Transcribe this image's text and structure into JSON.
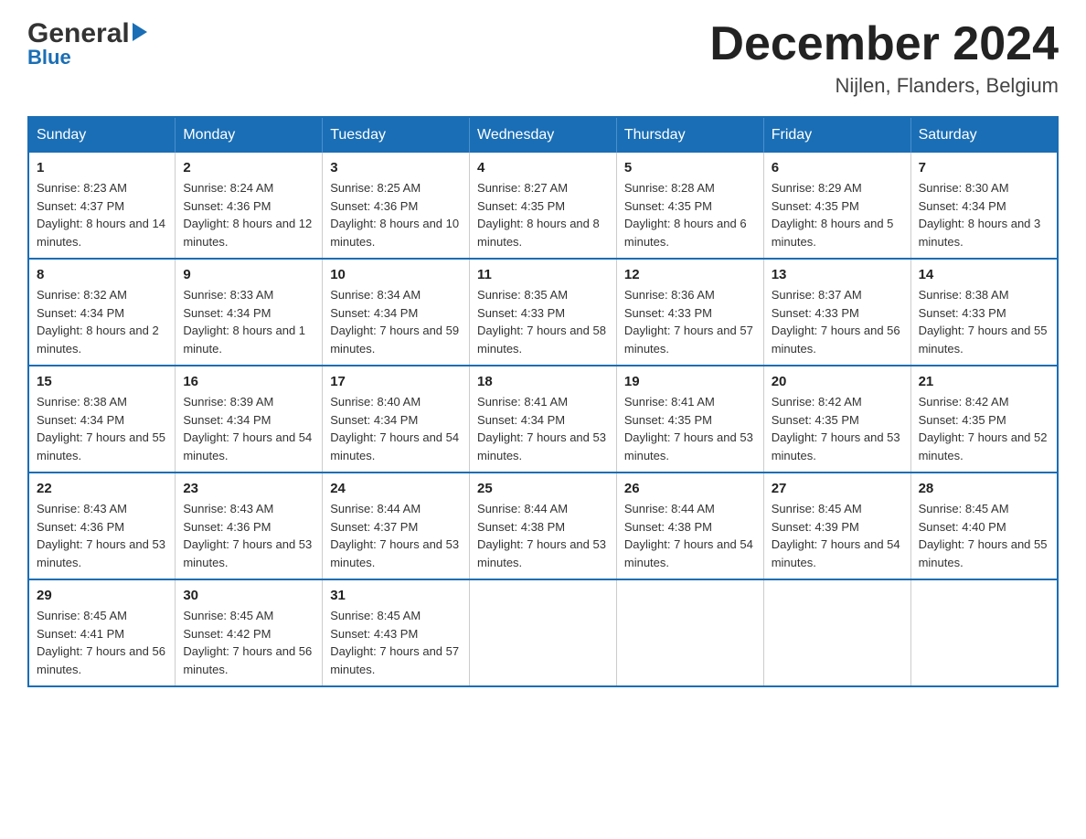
{
  "header": {
    "logo_general": "General",
    "logo_blue": "Blue",
    "month_title": "December 2024",
    "location": "Nijlen, Flanders, Belgium"
  },
  "calendar": {
    "days_of_week": [
      "Sunday",
      "Monday",
      "Tuesday",
      "Wednesday",
      "Thursday",
      "Friday",
      "Saturday"
    ],
    "weeks": [
      [
        {
          "day": "1",
          "sunrise": "Sunrise: 8:23 AM",
          "sunset": "Sunset: 4:37 PM",
          "daylight": "Daylight: 8 hours and 14 minutes."
        },
        {
          "day": "2",
          "sunrise": "Sunrise: 8:24 AM",
          "sunset": "Sunset: 4:36 PM",
          "daylight": "Daylight: 8 hours and 12 minutes."
        },
        {
          "day": "3",
          "sunrise": "Sunrise: 8:25 AM",
          "sunset": "Sunset: 4:36 PM",
          "daylight": "Daylight: 8 hours and 10 minutes."
        },
        {
          "day": "4",
          "sunrise": "Sunrise: 8:27 AM",
          "sunset": "Sunset: 4:35 PM",
          "daylight": "Daylight: 8 hours and 8 minutes."
        },
        {
          "day": "5",
          "sunrise": "Sunrise: 8:28 AM",
          "sunset": "Sunset: 4:35 PM",
          "daylight": "Daylight: 8 hours and 6 minutes."
        },
        {
          "day": "6",
          "sunrise": "Sunrise: 8:29 AM",
          "sunset": "Sunset: 4:35 PM",
          "daylight": "Daylight: 8 hours and 5 minutes."
        },
        {
          "day": "7",
          "sunrise": "Sunrise: 8:30 AM",
          "sunset": "Sunset: 4:34 PM",
          "daylight": "Daylight: 8 hours and 3 minutes."
        }
      ],
      [
        {
          "day": "8",
          "sunrise": "Sunrise: 8:32 AM",
          "sunset": "Sunset: 4:34 PM",
          "daylight": "Daylight: 8 hours and 2 minutes."
        },
        {
          "day": "9",
          "sunrise": "Sunrise: 8:33 AM",
          "sunset": "Sunset: 4:34 PM",
          "daylight": "Daylight: 8 hours and 1 minute."
        },
        {
          "day": "10",
          "sunrise": "Sunrise: 8:34 AM",
          "sunset": "Sunset: 4:34 PM",
          "daylight": "Daylight: 7 hours and 59 minutes."
        },
        {
          "day": "11",
          "sunrise": "Sunrise: 8:35 AM",
          "sunset": "Sunset: 4:33 PM",
          "daylight": "Daylight: 7 hours and 58 minutes."
        },
        {
          "day": "12",
          "sunrise": "Sunrise: 8:36 AM",
          "sunset": "Sunset: 4:33 PM",
          "daylight": "Daylight: 7 hours and 57 minutes."
        },
        {
          "day": "13",
          "sunrise": "Sunrise: 8:37 AM",
          "sunset": "Sunset: 4:33 PM",
          "daylight": "Daylight: 7 hours and 56 minutes."
        },
        {
          "day": "14",
          "sunrise": "Sunrise: 8:38 AM",
          "sunset": "Sunset: 4:33 PM",
          "daylight": "Daylight: 7 hours and 55 minutes."
        }
      ],
      [
        {
          "day": "15",
          "sunrise": "Sunrise: 8:38 AM",
          "sunset": "Sunset: 4:34 PM",
          "daylight": "Daylight: 7 hours and 55 minutes."
        },
        {
          "day": "16",
          "sunrise": "Sunrise: 8:39 AM",
          "sunset": "Sunset: 4:34 PM",
          "daylight": "Daylight: 7 hours and 54 minutes."
        },
        {
          "day": "17",
          "sunrise": "Sunrise: 8:40 AM",
          "sunset": "Sunset: 4:34 PM",
          "daylight": "Daylight: 7 hours and 54 minutes."
        },
        {
          "day": "18",
          "sunrise": "Sunrise: 8:41 AM",
          "sunset": "Sunset: 4:34 PM",
          "daylight": "Daylight: 7 hours and 53 minutes."
        },
        {
          "day": "19",
          "sunrise": "Sunrise: 8:41 AM",
          "sunset": "Sunset: 4:35 PM",
          "daylight": "Daylight: 7 hours and 53 minutes."
        },
        {
          "day": "20",
          "sunrise": "Sunrise: 8:42 AM",
          "sunset": "Sunset: 4:35 PM",
          "daylight": "Daylight: 7 hours and 53 minutes."
        },
        {
          "day": "21",
          "sunrise": "Sunrise: 8:42 AM",
          "sunset": "Sunset: 4:35 PM",
          "daylight": "Daylight: 7 hours and 52 minutes."
        }
      ],
      [
        {
          "day": "22",
          "sunrise": "Sunrise: 8:43 AM",
          "sunset": "Sunset: 4:36 PM",
          "daylight": "Daylight: 7 hours and 53 minutes."
        },
        {
          "day": "23",
          "sunrise": "Sunrise: 8:43 AM",
          "sunset": "Sunset: 4:36 PM",
          "daylight": "Daylight: 7 hours and 53 minutes."
        },
        {
          "day": "24",
          "sunrise": "Sunrise: 8:44 AM",
          "sunset": "Sunset: 4:37 PM",
          "daylight": "Daylight: 7 hours and 53 minutes."
        },
        {
          "day": "25",
          "sunrise": "Sunrise: 8:44 AM",
          "sunset": "Sunset: 4:38 PM",
          "daylight": "Daylight: 7 hours and 53 minutes."
        },
        {
          "day": "26",
          "sunrise": "Sunrise: 8:44 AM",
          "sunset": "Sunset: 4:38 PM",
          "daylight": "Daylight: 7 hours and 54 minutes."
        },
        {
          "day": "27",
          "sunrise": "Sunrise: 8:45 AM",
          "sunset": "Sunset: 4:39 PM",
          "daylight": "Daylight: 7 hours and 54 minutes."
        },
        {
          "day": "28",
          "sunrise": "Sunrise: 8:45 AM",
          "sunset": "Sunset: 4:40 PM",
          "daylight": "Daylight: 7 hours and 55 minutes."
        }
      ],
      [
        {
          "day": "29",
          "sunrise": "Sunrise: 8:45 AM",
          "sunset": "Sunset: 4:41 PM",
          "daylight": "Daylight: 7 hours and 56 minutes."
        },
        {
          "day": "30",
          "sunrise": "Sunrise: 8:45 AM",
          "sunset": "Sunset: 4:42 PM",
          "daylight": "Daylight: 7 hours and 56 minutes."
        },
        {
          "day": "31",
          "sunrise": "Sunrise: 8:45 AM",
          "sunset": "Sunset: 4:43 PM",
          "daylight": "Daylight: 7 hours and 57 minutes."
        },
        null,
        null,
        null,
        null
      ]
    ]
  }
}
